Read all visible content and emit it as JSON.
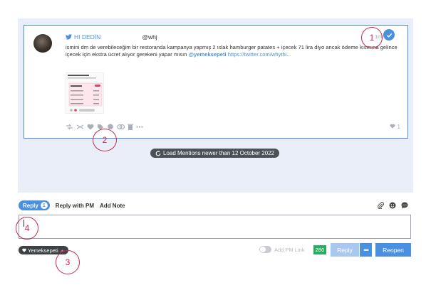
{
  "tweet": {
    "author_name": "HI DEDİN",
    "handle": "@whj",
    "time": "1m",
    "body_prefix": "ismini dm de verebileceğim bir restoranda kampanya yapmış 2 ıslak hamburger patates + içecek 71 lira diyo ancak ödeme kısmına gelince içecek için ekstra ücret alıyor gerekeni yapar mısın ",
    "mention": "@yemeksepeti",
    "link": "https://twitter.com/whythi...",
    "like_count": "1",
    "icons": [
      "retweet-icon",
      "shuffle-icon",
      "heart-icon",
      "tag-icon",
      "comment-icon",
      "mail-icon",
      "trash-icon",
      "more-icon"
    ]
  },
  "feed": {
    "load_button_label": "Load Mentions newer than 12 October 2022"
  },
  "reply_bar": {
    "tab_reply": "Reply",
    "tab_reply_count": "1",
    "tab_reply_pm": "Reply with PM",
    "tab_add_note": "Add Note",
    "tools": [
      "paperclip-icon",
      "emoji-icon",
      "chat-icon"
    ]
  },
  "composer": {
    "value": "",
    "tag_label": "Yemeksepeti",
    "pm_link_label": "Add PM Link",
    "char_count": "280",
    "reply_label": "Reply",
    "more_label": "•••",
    "reopen_label": "Reopen"
  },
  "annotations": [
    "1",
    "2",
    "3",
    "4"
  ],
  "colors": {
    "accent": "#4a90e2",
    "counter": "#27ae60",
    "callout": "#c62850",
    "feed_bg": "#e9eef8"
  }
}
